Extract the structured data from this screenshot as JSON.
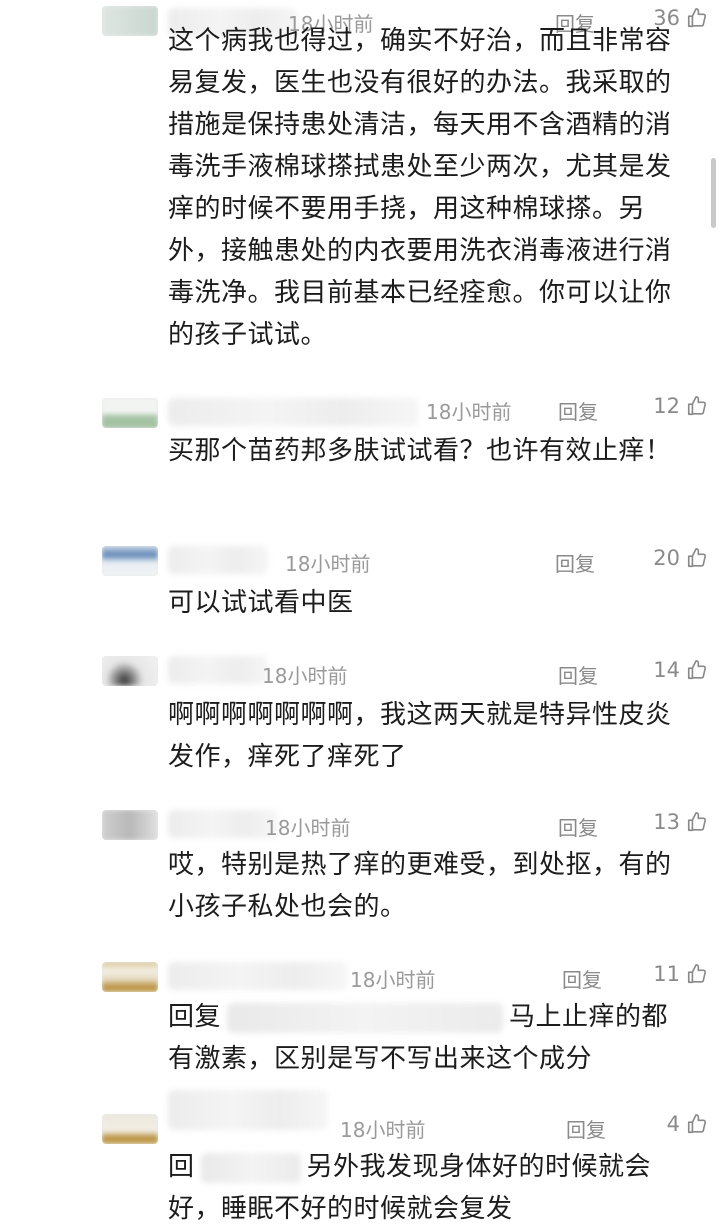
{
  "comments": [
    {
      "time": "18小时前",
      "reply": "回复",
      "likes": "36",
      "text": "这个病我也得过，确实不好治，而且非常容易复发，医生也没有很好的办法。我采取的措施是保持患处清洁，每天用不含酒精的消毒洗手液棉球搽拭患处至少两次，尤其是发痒的时候不要用手挠，用这种棉球搽。另外，接触患处的内衣要用洗衣消毒液进行消毒洗净。我目前基本已经痊愈。你可以让你的孩子试试。"
    },
    {
      "time": "18小时前",
      "reply": "回复",
      "likes": "12",
      "text": "买那个苗药邦多肤试试看？也许有效止痒！"
    },
    {
      "time": "18小时前",
      "reply": "回复",
      "likes": "20",
      "text": "可以试试看中医"
    },
    {
      "time": "18小时前",
      "reply": "回复",
      "likes": "14",
      "text": "啊啊啊啊啊啊啊，我这两天就是特异性皮炎发作，痒死了痒死了"
    },
    {
      "time": "18小时前",
      "reply": "回复",
      "likes": "13",
      "text": "哎，特别是热了痒的更难受，到处抠，有的小孩子私处也会的。"
    },
    {
      "time": "18小时前",
      "reply": "回复",
      "likes": "11",
      "text_prefix": "回复",
      "text": "马上止痒的都有激素，区别是写不写出来这个成分"
    },
    {
      "time": "18小时前",
      "reply": "回复",
      "likes": "4",
      "text_prefix": "回",
      "text": "另外我发现身体好的时候就会好，睡眠不好的时候就会复发"
    }
  ],
  "colors": {
    "text": "#1c1c1c",
    "meta": "#9a9a9a",
    "action": "#8a8a8a"
  },
  "icons": {
    "like": "thumbs-up-icon"
  }
}
